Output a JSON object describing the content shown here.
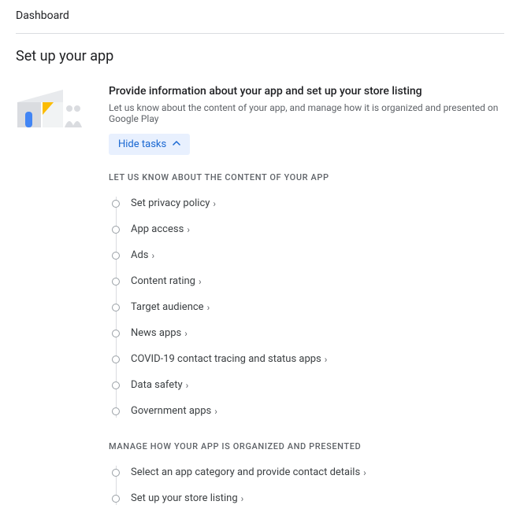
{
  "header": {
    "dashboard": "Dashboard",
    "setup": "Set up your app"
  },
  "card": {
    "title": "Provide information about your app and set up your store listing",
    "subtitle": "Let us know about the content of your app, and manage how it is organized and presented on Google Play",
    "toggle": "Hide tasks"
  },
  "sectionA": {
    "label": "LET US KNOW ABOUT THE CONTENT OF YOUR APP",
    "items": [
      "Set privacy policy",
      "App access",
      "Ads",
      "Content rating",
      "Target audience",
      "News apps",
      "COVID-19 contact tracing and status apps",
      "Data safety",
      "Government apps"
    ]
  },
  "sectionB": {
    "label": "MANAGE HOW YOUR APP IS ORGANIZED AND PRESENTED",
    "items": [
      "Select an app category and provide contact details",
      "Set up your store listing"
    ]
  }
}
